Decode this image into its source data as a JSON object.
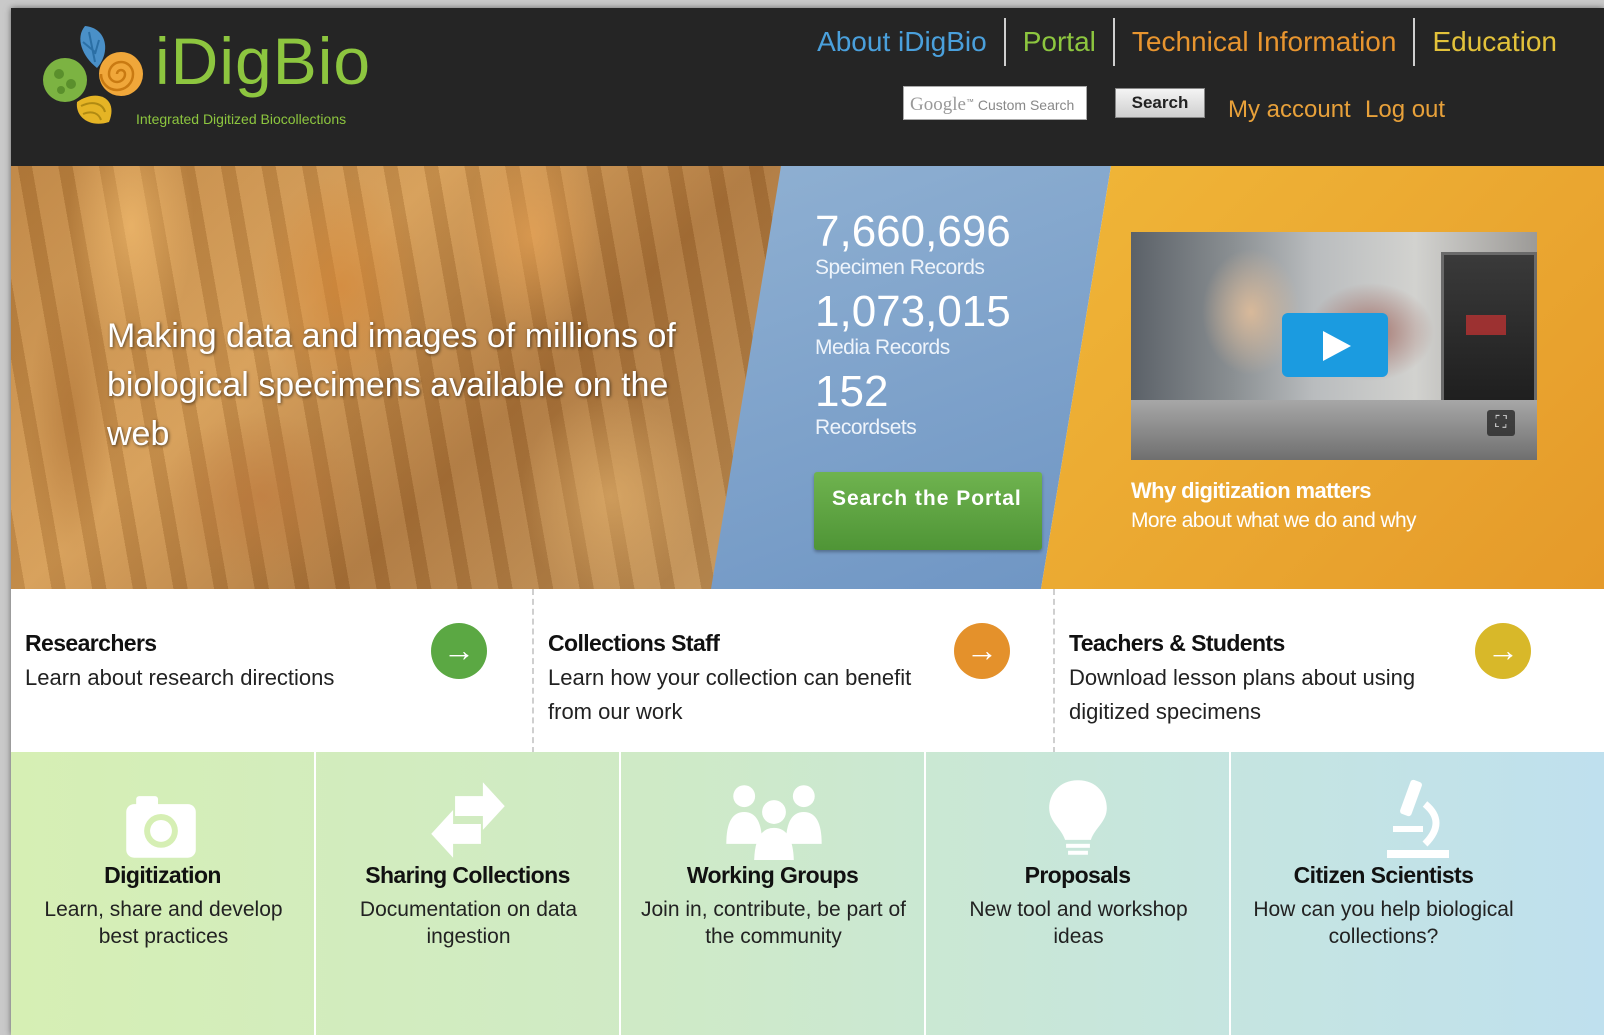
{
  "brand": {
    "name": "iDigBio",
    "tagline": "Integrated Digitized Biocollections"
  },
  "nav": [
    {
      "label": "About iDigBio",
      "color": "#4aa0dc"
    },
    {
      "label": "Portal",
      "color": "#8dc63f"
    },
    {
      "label": "Technical Information",
      "color": "#e8952f"
    },
    {
      "label": "Education",
      "color": "#e3c23a"
    }
  ],
  "search": {
    "google": "Google",
    "placeholder": "Custom Search",
    "button": "Search"
  },
  "account": {
    "my_account": "My account",
    "log_out": "Log out"
  },
  "hero": {
    "tagline": "Making data and images of millions of biological specimens available on the web",
    "stats": [
      {
        "value": "7,660,696",
        "label": "Specimen Records"
      },
      {
        "value": "1,073,015",
        "label": "Media Records"
      },
      {
        "value": "152",
        "label": "Recordsets"
      }
    ],
    "portal_button": "Search the Portal",
    "video": {
      "title": "Why digitization matters",
      "subtitle": "More about what we do and why"
    }
  },
  "audiences": [
    {
      "title": "Researchers",
      "desc": "Learn about research directions",
      "color": "#5ba843"
    },
    {
      "title": "Collections Staff",
      "desc": "Learn how your collection can benefit from our work",
      "color": "#e4912b"
    },
    {
      "title": "Teachers & Students",
      "desc": "Download lesson plans about using digitized specimens",
      "color": "#d8b829"
    }
  ],
  "tiles": [
    {
      "icon": "camera-icon",
      "title": "Digitization",
      "desc": "Learn, share and develop best practices"
    },
    {
      "icon": "exchange-arrows-icon",
      "title": "Sharing Collections",
      "desc": "Documentation on data ingestion"
    },
    {
      "icon": "people-icon",
      "title": "Working Groups",
      "desc": "Join in, contribute, be part of the community"
    },
    {
      "icon": "lightbulb-icon",
      "title": "Proposals",
      "desc": "New tool and workshop ideas"
    },
    {
      "icon": "microscope-icon",
      "title": "Citizen Scientists",
      "desc": "How can you help biological collections?"
    }
  ]
}
